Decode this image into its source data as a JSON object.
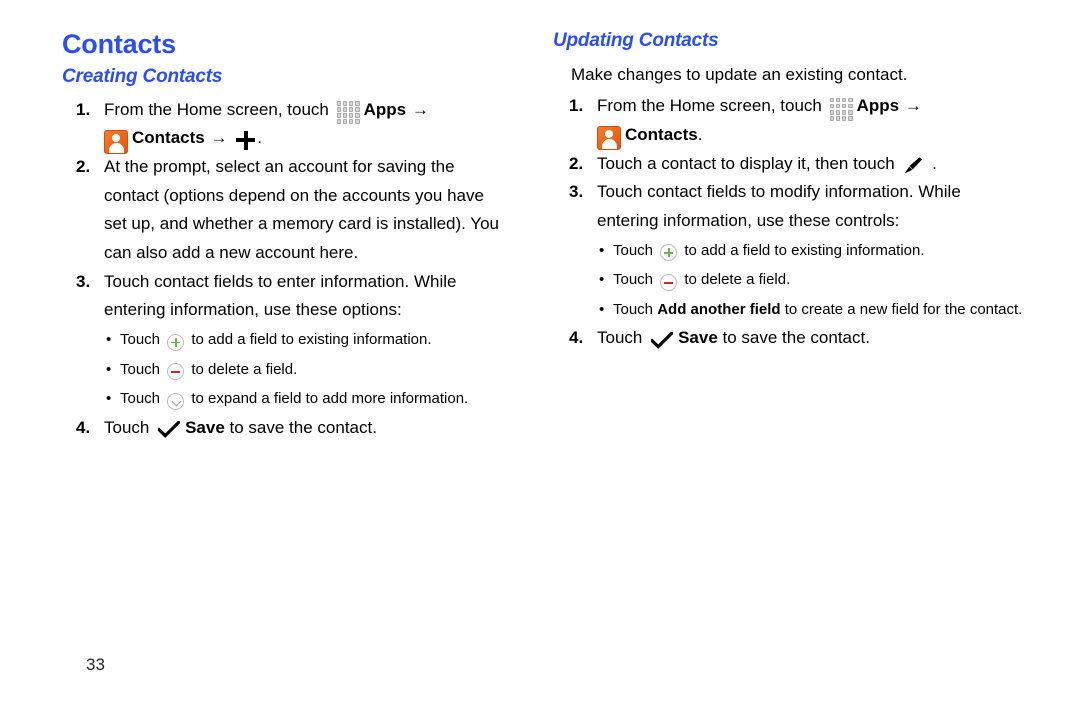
{
  "colors": {
    "heading_blue": "#2b4ef0",
    "icon_orange": "#ef6a1c",
    "plus_green": "#62bb46",
    "minus_red": "#e02020",
    "chevron_gray": "#9e9e9e",
    "text_black": "#000000"
  },
  "page_number": "33",
  "left_column": {
    "title": "Contacts",
    "subtitle": "Creating Contacts",
    "steps": [
      {
        "num": "1.",
        "parts": [
          {
            "type": "text",
            "text": "From the Home screen, touch "
          },
          {
            "type": "icon",
            "icon": "apps-grid-icon"
          },
          {
            "type": "bold",
            "text": "Apps"
          },
          {
            "type": "arrow",
            "text": "→"
          },
          {
            "type": "break"
          },
          {
            "type": "icon",
            "icon": "contacts-icon"
          },
          {
            "type": "bold",
            "text": "Contacts"
          },
          {
            "type": "arrow",
            "text": "→"
          },
          {
            "type": "icon",
            "icon": "plus-black-icon"
          },
          {
            "type": "text",
            "text": "."
          }
        ]
      },
      {
        "num": "2.",
        "text": "At the prompt, select an account for saving the contact (options depend on the accounts you have set up, and whether a memory card is installed). You can also add a new account here."
      },
      {
        "num": "3.",
        "text": "Touch contact fields to enter information. While entering information, use these options:",
        "bullets": [
          {
            "pre": "Touch ",
            "icon": "circle-plus-icon",
            "post": " to add a field to existing information."
          },
          {
            "pre": "Touch ",
            "icon": "circle-minus-icon",
            "post": " to delete a field."
          },
          {
            "pre": "Touch ",
            "icon": "circle-chevron-down-icon",
            "post": " to expand a field to add more information."
          }
        ]
      },
      {
        "num": "4.",
        "parts": [
          {
            "type": "text",
            "text": "Touch "
          },
          {
            "type": "icon",
            "icon": "check-icon"
          },
          {
            "type": "bold",
            "text": "Save"
          },
          {
            "type": "text",
            "text": " to save the contact."
          }
        ]
      }
    ]
  },
  "right_column": {
    "subtitle": "Updating Contacts",
    "intro": "Make changes to update an existing contact.",
    "steps": [
      {
        "num": "1.",
        "parts": [
          {
            "type": "text",
            "text": "From the Home screen, touch "
          },
          {
            "type": "icon",
            "icon": "apps-grid-icon"
          },
          {
            "type": "bold",
            "text": "Apps"
          },
          {
            "type": "arrow",
            "text": "→"
          },
          {
            "type": "break"
          },
          {
            "type": "icon",
            "icon": "contacts-icon"
          },
          {
            "type": "bold",
            "text": "Contacts"
          },
          {
            "type": "text",
            "text": "."
          }
        ]
      },
      {
        "num": "2.",
        "parts": [
          {
            "type": "text",
            "text": "Touch a contact to display it, then touch "
          },
          {
            "type": "icon",
            "icon": "pencil-icon"
          },
          {
            "type": "text",
            "text": " ."
          }
        ]
      },
      {
        "num": "3.",
        "text": "Touch contact fields to modify information. While entering information, use these controls:",
        "bullets": [
          {
            "pre": "Touch ",
            "icon": "circle-plus-icon",
            "post": " to add a field to existing information."
          },
          {
            "pre": "Touch ",
            "icon": "circle-minus-icon",
            "post": " to delete a field."
          },
          {
            "pre": "Touch ",
            "bold": "Add another field",
            "post": " to create a new field for the contact."
          }
        ]
      },
      {
        "num": "4.",
        "parts": [
          {
            "type": "text",
            "text": "Touch "
          },
          {
            "type": "icon",
            "icon": "check-icon"
          },
          {
            "type": "bold",
            "text": "Save"
          },
          {
            "type": "text",
            "text": " to save the contact."
          }
        ]
      }
    ]
  }
}
